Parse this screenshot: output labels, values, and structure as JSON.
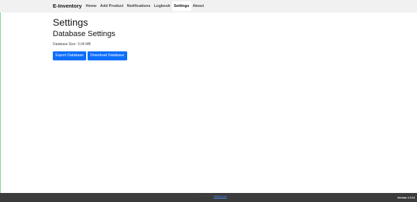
{
  "navbar": {
    "brand": "E-Inventory",
    "items": [
      {
        "label": "Home",
        "active": false
      },
      {
        "label": "Add Product",
        "active": false
      },
      {
        "label": "Notifications",
        "active": false
      },
      {
        "label": "Logbook",
        "active": false
      },
      {
        "label": "Settings",
        "active": true
      },
      {
        "label": "About",
        "active": false
      }
    ]
  },
  "main": {
    "title": "Settings",
    "section_title": "Database Settings",
    "db_size_label": "Database Size:",
    "db_size_value": "0.04 MB",
    "buttons": {
      "export": "Export Database",
      "download": "Download Database"
    }
  },
  "footer": {
    "credit_text": "· · · · · · · · · · · ·",
    "credit_link": "GitHub.com",
    "version": "Version 1.0.12"
  },
  "colors": {
    "primary_button": "#0d6efd",
    "navbar_bg": "#f1f1f1",
    "footer_bg": "#3b3b3b"
  }
}
